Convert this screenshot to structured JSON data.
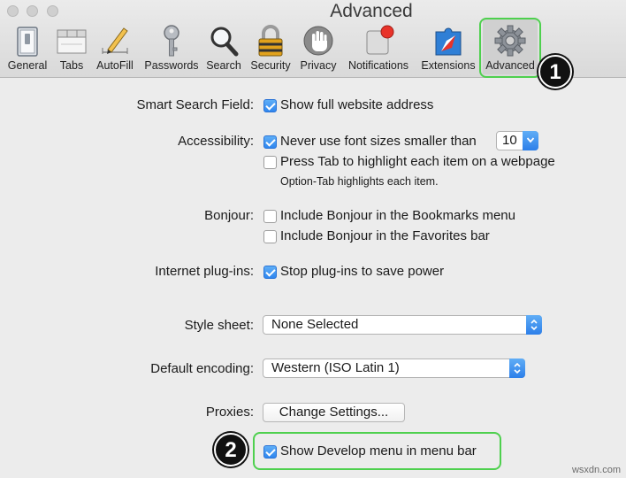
{
  "window": {
    "title": "Advanced"
  },
  "toolbar": {
    "tabs": [
      {
        "label": "General",
        "icon": "general-switch-icon"
      },
      {
        "label": "Tabs",
        "icon": "tabs-icon"
      },
      {
        "label": "AutoFill",
        "icon": "autofill-pencil-icon"
      },
      {
        "label": "Passwords",
        "icon": "key-icon"
      },
      {
        "label": "Search",
        "icon": "magnifier-icon"
      },
      {
        "label": "Security",
        "icon": "lock-icon"
      },
      {
        "label": "Privacy",
        "icon": "hand-icon"
      },
      {
        "label": "Notifications",
        "icon": "notification-badge-icon"
      },
      {
        "label": "Extensions",
        "icon": "puzzle-compass-icon"
      },
      {
        "label": "Advanced",
        "icon": "gear-icon",
        "selected": true
      }
    ]
  },
  "callouts": {
    "one": "1",
    "two": "2"
  },
  "settings": {
    "smart_search": {
      "label": "Smart Search Field:",
      "show_full_address": {
        "label": "Show full website address",
        "checked": true
      }
    },
    "accessibility": {
      "label": "Accessibility:",
      "font_size": {
        "label": "Never use font sizes smaller than",
        "checked": true,
        "value": "10"
      },
      "press_tab": {
        "label": "Press Tab to highlight each item on a webpage",
        "checked": false
      },
      "note": "Option-Tab highlights each item."
    },
    "bonjour": {
      "label": "Bonjour:",
      "bookmarks": {
        "label": "Include Bonjour in the Bookmarks menu",
        "checked": false
      },
      "favorites": {
        "label": "Include Bonjour in the Favorites bar",
        "checked": false
      }
    },
    "plugins": {
      "label": "Internet plug-ins:",
      "stop": {
        "label": "Stop plug-ins to save power",
        "checked": true
      }
    },
    "style_sheet": {
      "label": "Style sheet:",
      "value": "None Selected"
    },
    "encoding": {
      "label": "Default encoding:",
      "value": "Western (ISO Latin 1)"
    },
    "proxies": {
      "label": "Proxies:",
      "button": "Change Settings..."
    },
    "develop": {
      "label": "Show Develop menu in menu bar",
      "checked": true
    }
  },
  "watermark": "wsxdn.com",
  "colors": {
    "accent_blue": "#2f86ef",
    "callout_green": "#4ed04e"
  }
}
